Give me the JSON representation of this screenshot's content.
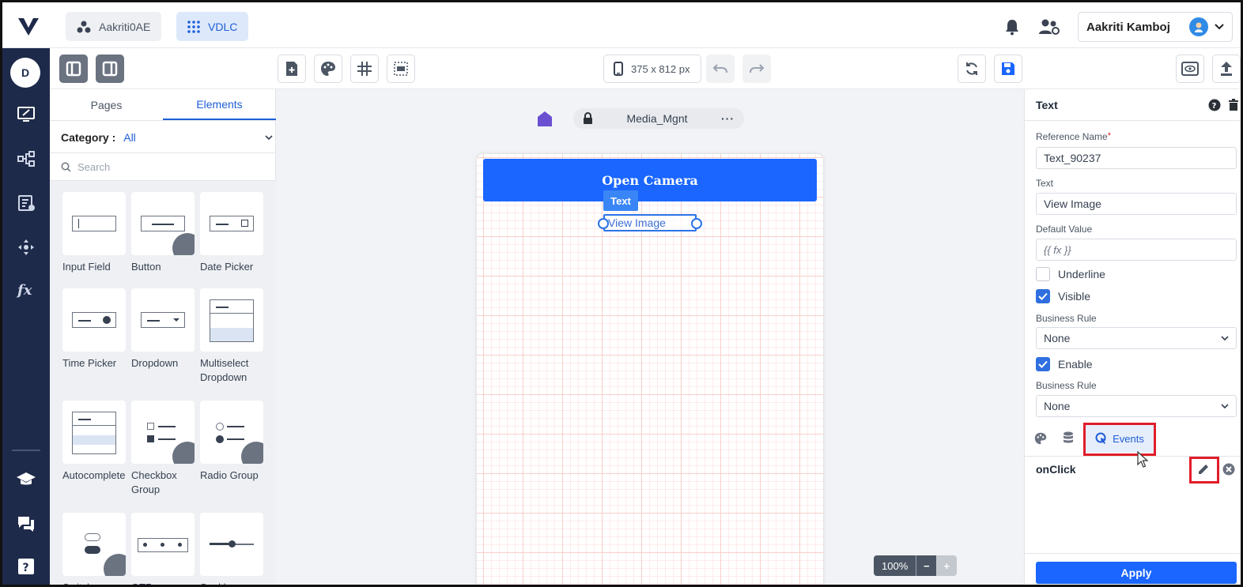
{
  "topbar": {
    "org_label": "Aakriti0AE",
    "app_label": "VDLC",
    "user_name": "Aakriti Kamboj"
  },
  "leftnav": {
    "avatar_letter": "D"
  },
  "toolbar": {
    "device_size": "375 x 812 px"
  },
  "left_panel": {
    "tabs": [
      {
        "label": "Pages"
      },
      {
        "label": "Elements",
        "active": true
      }
    ],
    "category_label": "Category :",
    "category_value": "All",
    "search_placeholder": "Search",
    "elements": [
      {
        "label": "Input Field"
      },
      {
        "label": "Button"
      },
      {
        "label": "Date Picker"
      },
      {
        "label": "Time Picker"
      },
      {
        "label": "Dropdown"
      },
      {
        "label": "Multiselect Dropdown"
      },
      {
        "label": "Autocomplete"
      },
      {
        "label": "Checkbox Group"
      },
      {
        "label": "Radio Group"
      },
      {
        "label": "Switch"
      },
      {
        "label": "OTP"
      },
      {
        "label": "Seekbar"
      }
    ]
  },
  "canvas": {
    "page_name": "Media_Mgnt",
    "page_menu": "···",
    "button_text": "Open Camera",
    "selected_tag": "Text",
    "selected_text": "View Image",
    "zoom": "100%",
    "zoom_minus": "−",
    "zoom_plus": "+"
  },
  "right_panel": {
    "title": "Text",
    "reference_name_label": "Reference Name",
    "reference_name_required": "*",
    "reference_name": "Text_90237",
    "text_label": "Text",
    "text_value": "View Image",
    "default_value_label": "Default Value",
    "default_value_placeholder": "{{ fx }}",
    "underline_label": "Underline",
    "underline_checked": false,
    "visible_label": "Visible",
    "visible_checked": true,
    "business_rule_label_1": "Business Rule",
    "business_rule_value_1": "None",
    "enable_label": "Enable",
    "enable_checked": true,
    "business_rule_label_2": "Business Rule",
    "business_rule_value_2": "None",
    "events_tab_label": "Events",
    "event_name": "onClick",
    "apply_label": "Apply"
  },
  "colors": {
    "brand_blue": "#1a66ff",
    "nav_bg": "#1e2a4a",
    "highlight_red": "#e11d2a"
  }
}
